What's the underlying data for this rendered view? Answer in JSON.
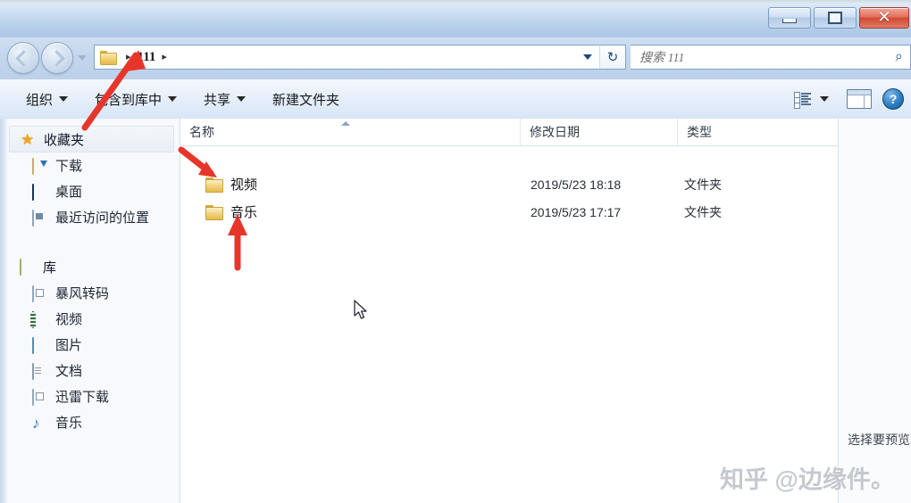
{
  "window": {
    "controls": {
      "minimize_label": "—",
      "maximize_label": "",
      "close_label": "✕"
    }
  },
  "addressbar": {
    "folder_icon": "folder-icon",
    "separator": "▸",
    "path_label": "111",
    "dropdown_icon": "chevron-down-icon",
    "refresh_icon": "refresh-icon",
    "refresh_label": "↻"
  },
  "search": {
    "placeholder": "搜索 111",
    "icon": "search-icon",
    "icon_glyph": "⌕"
  },
  "toolbar": {
    "items": [
      {
        "label": "组织",
        "has_caret": true
      },
      {
        "label": "包含到库中",
        "has_caret": true
      },
      {
        "label": "共享",
        "has_caret": true
      },
      {
        "label": "新建文件夹",
        "has_caret": false
      }
    ],
    "view_icon": "view-options-icon",
    "view_caret_icon": "chevron-down-icon",
    "preview_pane_icon": "preview-pane-toggle-icon",
    "help_icon": "help-icon",
    "help_label": "?"
  },
  "sidebar": {
    "groups": [
      {
        "label": "收藏夹",
        "icon": "star-icon",
        "items": [
          {
            "label": "下载",
            "icon": "downloads-icon"
          },
          {
            "label": "桌面",
            "icon": "desktop-icon"
          },
          {
            "label": "最近访问的位置",
            "icon": "recent-places-icon"
          }
        ]
      },
      {
        "label": "库",
        "icon": "library-icon",
        "items": [
          {
            "label": "暴风转码",
            "icon": "baofeng-transcode-icon"
          },
          {
            "label": "视频",
            "icon": "video-icon"
          },
          {
            "label": "图片",
            "icon": "pictures-icon"
          },
          {
            "label": "文档",
            "icon": "documents-icon"
          },
          {
            "label": "迅雷下载",
            "icon": "thunder-download-icon"
          },
          {
            "label": "音乐",
            "icon": "music-icon"
          }
        ]
      }
    ]
  },
  "filelist": {
    "columns": [
      {
        "label": "名称",
        "sorted": "asc"
      },
      {
        "label": "修改日期",
        "sorted": ""
      },
      {
        "label": "类型",
        "sorted": ""
      }
    ],
    "rows": [
      {
        "name": "视频",
        "date": "2019/5/23 18:18",
        "type": "文件夹",
        "icon": "folder-icon"
      },
      {
        "name": "音乐",
        "date": "2019/5/23 17:17",
        "type": "文件夹",
        "icon": "folder-icon"
      }
    ]
  },
  "preview": {
    "message": "选择要预览"
  },
  "annotations": {
    "arrow_color": "#e8352a",
    "arrows": [
      {
        "name": "arrow-to-breadcrumb",
        "target": "111"
      },
      {
        "name": "arrow-to-video-folder",
        "target": "视频"
      },
      {
        "name": "arrow-to-music-folder",
        "target": "音乐"
      }
    ]
  },
  "watermark": {
    "text": "知乎 @边缘件。"
  }
}
